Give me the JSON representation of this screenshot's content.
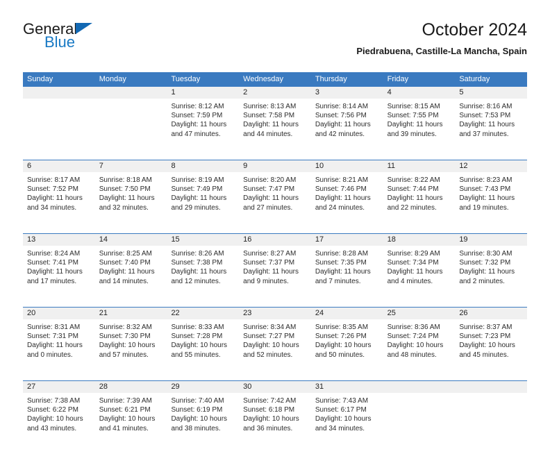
{
  "brand": {
    "name_part1": "General",
    "name_part2": "Blue",
    "triangle_icon": "blue-triangle-icon",
    "color_dark": "#1a1a1a",
    "color_blue": "#1879c4"
  },
  "header": {
    "title": "October 2024",
    "subtitle": "Piedrabuena, Castille-La Mancha, Spain"
  },
  "theme": {
    "header_blue": "#3a7ac0",
    "daynum_band": "#f0f0f0",
    "text": "#2b2b2b"
  },
  "calendar": {
    "weekday_headers": [
      "Sunday",
      "Monday",
      "Tuesday",
      "Wednesday",
      "Thursday",
      "Friday",
      "Saturday"
    ],
    "weeks": [
      [
        {
          "day": "",
          "lines": []
        },
        {
          "day": "",
          "lines": []
        },
        {
          "day": "1",
          "lines": [
            "Sunrise: 8:12 AM",
            "Sunset: 7:59 PM",
            "Daylight: 11 hours",
            "and 47 minutes."
          ]
        },
        {
          "day": "2",
          "lines": [
            "Sunrise: 8:13 AM",
            "Sunset: 7:58 PM",
            "Daylight: 11 hours",
            "and 44 minutes."
          ]
        },
        {
          "day": "3",
          "lines": [
            "Sunrise: 8:14 AM",
            "Sunset: 7:56 PM",
            "Daylight: 11 hours",
            "and 42 minutes."
          ]
        },
        {
          "day": "4",
          "lines": [
            "Sunrise: 8:15 AM",
            "Sunset: 7:55 PM",
            "Daylight: 11 hours",
            "and 39 minutes."
          ]
        },
        {
          "day": "5",
          "lines": [
            "Sunrise: 8:16 AM",
            "Sunset: 7:53 PM",
            "Daylight: 11 hours",
            "and 37 minutes."
          ]
        }
      ],
      [
        {
          "day": "6",
          "lines": [
            "Sunrise: 8:17 AM",
            "Sunset: 7:52 PM",
            "Daylight: 11 hours",
            "and 34 minutes."
          ]
        },
        {
          "day": "7",
          "lines": [
            "Sunrise: 8:18 AM",
            "Sunset: 7:50 PM",
            "Daylight: 11 hours",
            "and 32 minutes."
          ]
        },
        {
          "day": "8",
          "lines": [
            "Sunrise: 8:19 AM",
            "Sunset: 7:49 PM",
            "Daylight: 11 hours",
            "and 29 minutes."
          ]
        },
        {
          "day": "9",
          "lines": [
            "Sunrise: 8:20 AM",
            "Sunset: 7:47 PM",
            "Daylight: 11 hours",
            "and 27 minutes."
          ]
        },
        {
          "day": "10",
          "lines": [
            "Sunrise: 8:21 AM",
            "Sunset: 7:46 PM",
            "Daylight: 11 hours",
            "and 24 minutes."
          ]
        },
        {
          "day": "11",
          "lines": [
            "Sunrise: 8:22 AM",
            "Sunset: 7:44 PM",
            "Daylight: 11 hours",
            "and 22 minutes."
          ]
        },
        {
          "day": "12",
          "lines": [
            "Sunrise: 8:23 AM",
            "Sunset: 7:43 PM",
            "Daylight: 11 hours",
            "and 19 minutes."
          ]
        }
      ],
      [
        {
          "day": "13",
          "lines": [
            "Sunrise: 8:24 AM",
            "Sunset: 7:41 PM",
            "Daylight: 11 hours",
            "and 17 minutes."
          ]
        },
        {
          "day": "14",
          "lines": [
            "Sunrise: 8:25 AM",
            "Sunset: 7:40 PM",
            "Daylight: 11 hours",
            "and 14 minutes."
          ]
        },
        {
          "day": "15",
          "lines": [
            "Sunrise: 8:26 AM",
            "Sunset: 7:38 PM",
            "Daylight: 11 hours",
            "and 12 minutes."
          ]
        },
        {
          "day": "16",
          "lines": [
            "Sunrise: 8:27 AM",
            "Sunset: 7:37 PM",
            "Daylight: 11 hours",
            "and 9 minutes."
          ]
        },
        {
          "day": "17",
          "lines": [
            "Sunrise: 8:28 AM",
            "Sunset: 7:35 PM",
            "Daylight: 11 hours",
            "and 7 minutes."
          ]
        },
        {
          "day": "18",
          "lines": [
            "Sunrise: 8:29 AM",
            "Sunset: 7:34 PM",
            "Daylight: 11 hours",
            "and 4 minutes."
          ]
        },
        {
          "day": "19",
          "lines": [
            "Sunrise: 8:30 AM",
            "Sunset: 7:32 PM",
            "Daylight: 11 hours",
            "and 2 minutes."
          ]
        }
      ],
      [
        {
          "day": "20",
          "lines": [
            "Sunrise: 8:31 AM",
            "Sunset: 7:31 PM",
            "Daylight: 11 hours",
            "and 0 minutes."
          ]
        },
        {
          "day": "21",
          "lines": [
            "Sunrise: 8:32 AM",
            "Sunset: 7:30 PM",
            "Daylight: 10 hours",
            "and 57 minutes."
          ]
        },
        {
          "day": "22",
          "lines": [
            "Sunrise: 8:33 AM",
            "Sunset: 7:28 PM",
            "Daylight: 10 hours",
            "and 55 minutes."
          ]
        },
        {
          "day": "23",
          "lines": [
            "Sunrise: 8:34 AM",
            "Sunset: 7:27 PM",
            "Daylight: 10 hours",
            "and 52 minutes."
          ]
        },
        {
          "day": "24",
          "lines": [
            "Sunrise: 8:35 AM",
            "Sunset: 7:26 PM",
            "Daylight: 10 hours",
            "and 50 minutes."
          ]
        },
        {
          "day": "25",
          "lines": [
            "Sunrise: 8:36 AM",
            "Sunset: 7:24 PM",
            "Daylight: 10 hours",
            "and 48 minutes."
          ]
        },
        {
          "day": "26",
          "lines": [
            "Sunrise: 8:37 AM",
            "Sunset: 7:23 PM",
            "Daylight: 10 hours",
            "and 45 minutes."
          ]
        }
      ],
      [
        {
          "day": "27",
          "lines": [
            "Sunrise: 7:38 AM",
            "Sunset: 6:22 PM",
            "Daylight: 10 hours",
            "and 43 minutes."
          ]
        },
        {
          "day": "28",
          "lines": [
            "Sunrise: 7:39 AM",
            "Sunset: 6:21 PM",
            "Daylight: 10 hours",
            "and 41 minutes."
          ]
        },
        {
          "day": "29",
          "lines": [
            "Sunrise: 7:40 AM",
            "Sunset: 6:19 PM",
            "Daylight: 10 hours",
            "and 38 minutes."
          ]
        },
        {
          "day": "30",
          "lines": [
            "Sunrise: 7:42 AM",
            "Sunset: 6:18 PM",
            "Daylight: 10 hours",
            "and 36 minutes."
          ]
        },
        {
          "day": "31",
          "lines": [
            "Sunrise: 7:43 AM",
            "Sunset: 6:17 PM",
            "Daylight: 10 hours",
            "and 34 minutes."
          ]
        },
        {
          "day": "",
          "lines": []
        },
        {
          "day": "",
          "lines": []
        }
      ]
    ]
  }
}
